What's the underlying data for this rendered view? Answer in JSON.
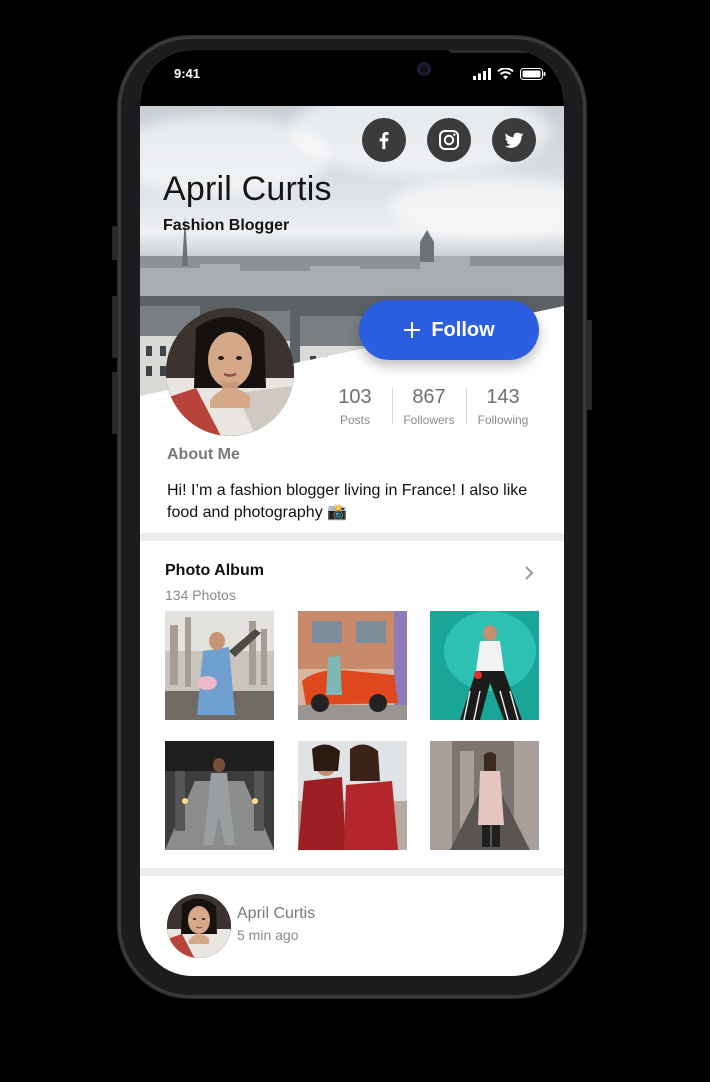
{
  "status_bar": {
    "time": "9:41"
  },
  "profile": {
    "name": "April Curtis",
    "title": "Fashion Blogger",
    "follow_label": "Follow",
    "social": [
      "facebook-icon",
      "instagram-icon",
      "twitter-icon"
    ]
  },
  "stats": [
    {
      "value": "103",
      "label": "Posts"
    },
    {
      "value": "867",
      "label": "Followers"
    },
    {
      "value": "143",
      "label": "Following"
    }
  ],
  "about": {
    "heading": "About Me",
    "text": "Hi! I’m a fashion blogger living in France! I also like food and photography 📸"
  },
  "album": {
    "heading": "Photo Album",
    "count": "134 Photos"
  },
  "post": {
    "author": "April Curtis",
    "time": "5 min ago"
  },
  "colors": {
    "accent": "#2b5fe0",
    "social_bg": "#3b3b3b",
    "divider": "#ececec"
  }
}
